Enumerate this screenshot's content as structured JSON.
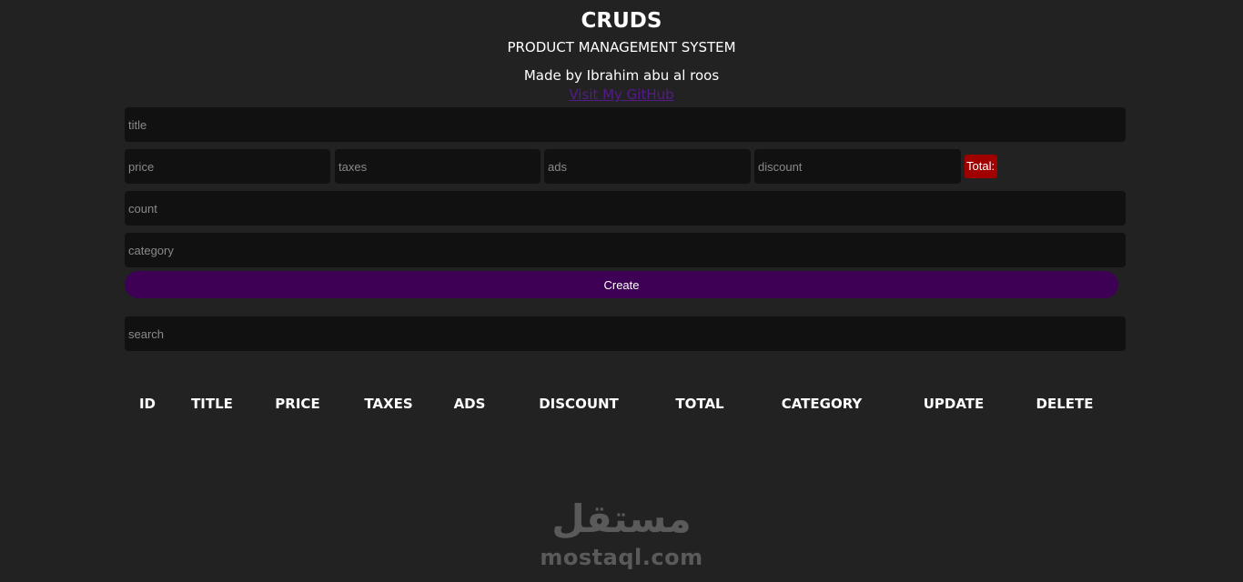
{
  "header": {
    "title": "CRUDS",
    "subtitle": "PRODUCT MANAGEMENT SYSTEM",
    "author": "Made by Ibrahim abu al roos",
    "github_link": "Visit My GitHub"
  },
  "form": {
    "title_placeholder": "title",
    "price_placeholder": "price",
    "taxes_placeholder": "taxes",
    "ads_placeholder": "ads",
    "discount_placeholder": "discount",
    "total_label": "Total:",
    "count_placeholder": "count",
    "category_placeholder": "category",
    "create_label": "Create",
    "search_placeholder": "search"
  },
  "table": {
    "columns": [
      "ID",
      "TITLE",
      "PRICE",
      "TAXES",
      "ADS",
      "DISCOUNT",
      "TOTAL",
      "CATEGORY",
      "UPDATE",
      "DELETE"
    ]
  },
  "watermark": {
    "arabic": "مستقل",
    "latin": "mostaql.com"
  },
  "colors": {
    "background": "#222222",
    "input_background": "#111111",
    "create_button": "#3d0054",
    "total_badge": "#a00000",
    "link": "#551a8b"
  }
}
